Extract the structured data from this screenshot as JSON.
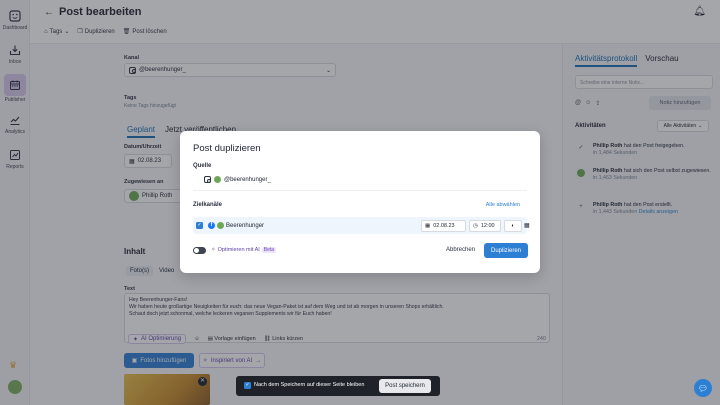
{
  "nav": [
    {
      "label": "Dashboard",
      "icon": "dashboard-icon"
    },
    {
      "label": "Inbox",
      "icon": "inbox-icon"
    },
    {
      "label": "Publisher",
      "icon": "calendar-icon"
    },
    {
      "label": "Analytics",
      "icon": "chart-icon"
    },
    {
      "label": "Reports",
      "icon": "report-icon"
    }
  ],
  "header": {
    "title": "Post bearbeiten",
    "toolbar": {
      "tags": "Tags",
      "duplicate": "Duplizieren",
      "delete": "Post löschen"
    }
  },
  "form": {
    "channel_label": "Kanal",
    "channel_value": "@beerenhunger_",
    "tags_label": "Tags",
    "tags_empty": "Keine Tags hinzugefügt",
    "tab_planned": "Geplant",
    "tab_publish_now": "Jetzt veröffentlichen",
    "date_label": "Datum/Uhrzeit",
    "date_value": "02.08.23",
    "assigned_label": "Zugewiesen an",
    "assigned_value": "Phillip Roth",
    "content_title": "Inhalt",
    "media_tab_photo": "Foto(s)",
    "media_tab_video": "Video",
    "text_label": "Text",
    "text_line1": "Hey Beerenhunger-Fans!",
    "text_line2": "Wir haben heute großartige Neuigkeiten für euch: das neue Vegan-Paket ist auf dem Weg und ist ab morgen in unseren Shops erhältlich.",
    "text_line3": "Schaut doch jetzt schonmal, welche leckeren veganen Supplements wir für Euch haben!",
    "ai_optimize": "AI Optimierung",
    "template_insert": "Vorlage einfügen",
    "shorten_links": "Links kürzen",
    "char_count": "240",
    "add_photos": "Fotos hinzufügen",
    "inspired_ai": "Inspiriert von AI"
  },
  "right_panel": {
    "tab_activity": "Aktivitätsprotokoll",
    "tab_preview": "Vorschau",
    "note_placeholder": "Schreibe eine interne Notiz...",
    "note_button": "Notiz hinzufügen",
    "activities_title": "Aktivitäten",
    "activities_filter": "Alle Aktivitäten",
    "items": [
      {
        "name": "Phillip Roth",
        "action": "hat den Post freigegeben.",
        "time": "in 1,484 Sekunden",
        "extra": ""
      },
      {
        "name": "Phillip Roth",
        "action": "hat sich den Post selbst zugewiesen.",
        "time": "in 1,463 Sekunden",
        "extra": ""
      },
      {
        "name": "Phillip Roth",
        "action": "hat den Post erstellt.",
        "time": "in 1,443 Sekunden",
        "extra": "Details anzeigen"
      }
    ]
  },
  "modal": {
    "title": "Post duplizieren",
    "source_label": "Quelle",
    "source_account": "@beerenhunger_",
    "targets_label": "Zielkanäle",
    "deselect_all": "Alle abwählen",
    "target_name": "Beerenhunger",
    "target_date": "02.08.23",
    "target_time": "12:00",
    "optimize_ai": "Optimieren mit AI",
    "beta": "Beta",
    "cancel": "Abbrechen",
    "duplicate": "Duplizieren"
  },
  "savebar": {
    "stay_label": "Nach dem Speichern auf dieser Seite bleiben",
    "save_button": "Post speichern"
  },
  "colors": {
    "accent": "#2d7fd4",
    "ai_purple": "#5e3ea8",
    "active_nav": "#d7c6ec"
  }
}
